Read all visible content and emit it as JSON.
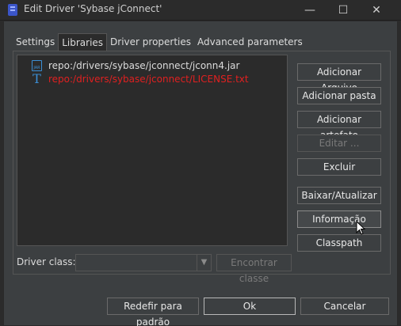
{
  "window": {
    "title": "Edit Driver 'Sybase jConnect'",
    "minimize_glyph": "—",
    "maximize_glyph": "☐",
    "close_glyph": "✕"
  },
  "tabs": [
    {
      "label": "Settings"
    },
    {
      "label": "Libraries"
    },
    {
      "label": "Driver properties"
    },
    {
      "label": "Advanced parameters"
    }
  ],
  "active_tab": "Libraries",
  "libraries": [
    {
      "path": "repo:/drivers/sybase/jconnect/jconn4.jar",
      "icon": "jar-file-icon",
      "missing": false
    },
    {
      "path": "repo:/drivers/sybase/jconnect/LICENSE.txt",
      "icon": "text-file-icon",
      "missing": true
    }
  ],
  "side_buttons": {
    "add_file": "Adicionar Arquivo",
    "add_folder": "Adicionar pasta",
    "add_artifact": "Adicionar artefato",
    "edit": "Editar ...",
    "delete": "Excluir",
    "download_update": "Baixar/Atualizar",
    "information": "Informação",
    "classpath": "Classpath"
  },
  "driver_class": {
    "label": "Driver class:",
    "value": "",
    "find_button": "Encontrar classe"
  },
  "footer": {
    "reset_defaults": "Redefir para padrão",
    "ok": "Ok",
    "cancel": "Cancelar"
  },
  "colors": {
    "background": "#3c3f41",
    "list_background": "#2b2b2b",
    "missing_file": "#e02020",
    "icon_blue": "#3b8fd6"
  }
}
